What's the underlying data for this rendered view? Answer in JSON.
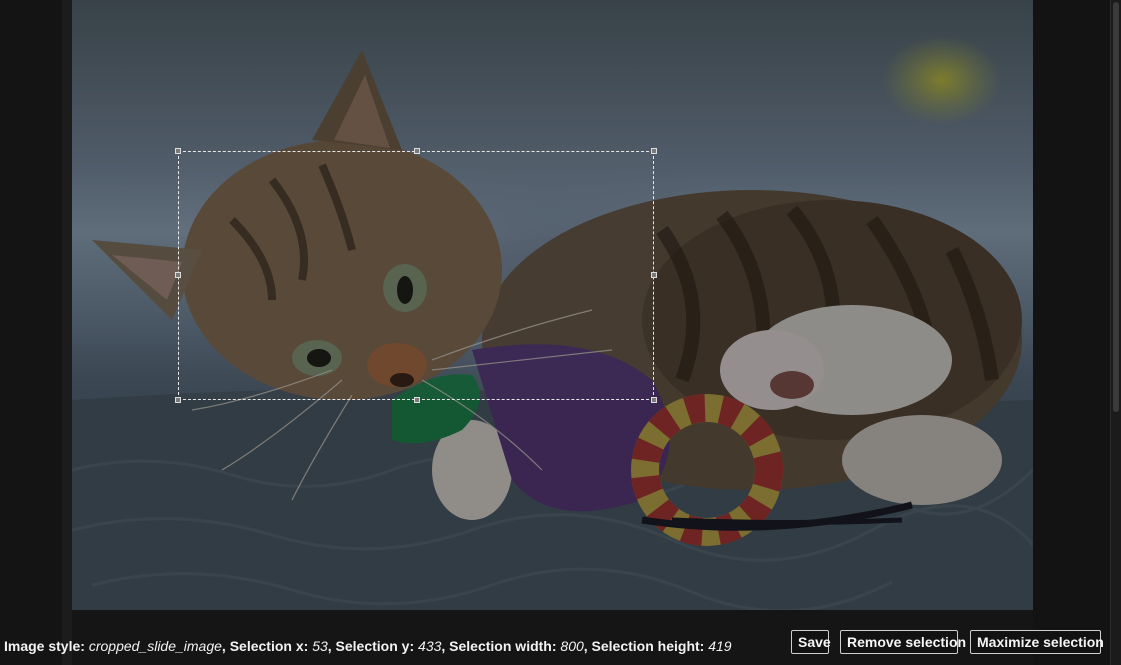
{
  "image": {
    "alt": "Tabby kitten lying on a blue quilt holding a purple and green toy"
  },
  "status": {
    "image_style_label": "Image style:",
    "image_style_value": "cropped_slide_image",
    "selection_x_label": "Selection x:",
    "selection_x_value": "53",
    "selection_y_label": "Selection y:",
    "selection_y_value": "433",
    "selection_width_label": "Selection width:",
    "selection_width_value": "800",
    "selection_height_label": "Selection height:",
    "selection_height_value": "419"
  },
  "toolbar": {
    "save_label": "Save",
    "remove_label": "Remove selection",
    "maximize_label": "Maximize selection"
  }
}
